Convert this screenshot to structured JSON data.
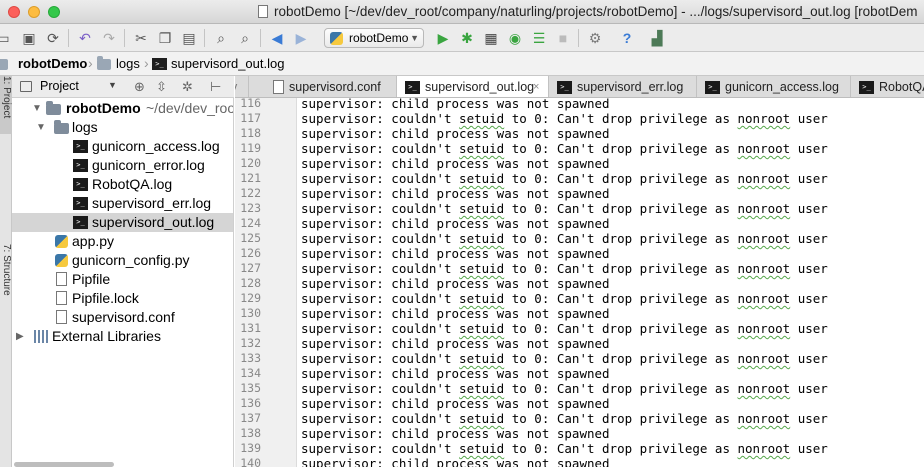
{
  "window": {
    "title": "robotDemo [~/dev/dev_root/company/naturling/projects/robotDemo] - .../logs/supervisord_out.log [robotDem"
  },
  "toolbar": {
    "run_config": "robotDemo",
    "icons": [
      "folder-open-icon",
      "save-icon",
      "sync-icon",
      "undo-icon",
      "redo-icon",
      "cut-icon",
      "copy-icon",
      "paste-icon",
      "find-icon",
      "replace-icon",
      "back-icon",
      "forward-icon",
      "run-icon",
      "debug-icon",
      "coverage-icon",
      "profile-icon",
      "concurrency-icon",
      "stop-icon",
      "settings-icon",
      "help-icon",
      "terminal-icon"
    ]
  },
  "breadcrumb": {
    "items": [
      "robotDemo",
      "logs",
      "supervisord_out.log"
    ]
  },
  "tool_strip": {
    "project_label": "1: Project",
    "structure_label": "7: Structure"
  },
  "project_panel": {
    "title": "Project",
    "tree": [
      {
        "label": "robotDemo",
        "path": "~/dev/dev_root/c"
      },
      {
        "label": "logs"
      },
      {
        "label": "gunicorn_access.log"
      },
      {
        "label": "gunicorn_error.log"
      },
      {
        "label": "RobotQA.log"
      },
      {
        "label": "supervisord_err.log"
      },
      {
        "label": "supervisord_out.log"
      },
      {
        "label": "app.py"
      },
      {
        "label": "gunicorn_config.py"
      },
      {
        "label": "Pipfile"
      },
      {
        "label": "Pipfile.lock"
      },
      {
        "label": "supervisord.conf"
      },
      {
        "label": "External Libraries"
      }
    ]
  },
  "tabs": [
    {
      "label": "y"
    },
    {
      "label": "supervisord.conf"
    },
    {
      "label": "supervisord_out.log"
    },
    {
      "label": "supervisord_err.log"
    },
    {
      "label": "gunicorn_access.log"
    },
    {
      "label": "RobotQA"
    }
  ],
  "editor": {
    "lines": [
      {
        "n": "116",
        "pre": "supervisor: child process was not spawned",
        "word": "",
        "post": ""
      },
      {
        "n": "117",
        "pre": "supervisor: couldn't ",
        "word": "setuid",
        "post": " to 0: Can't drop privilege as ",
        "word2": "nonroot",
        "post2": " user"
      },
      {
        "n": "118",
        "pre": "supervisor: child process was not spawned",
        "word": "",
        "post": ""
      },
      {
        "n": "119",
        "pre": "supervisor: couldn't ",
        "word": "setuid",
        "post": " to 0: Can't drop privilege as ",
        "word2": "nonroot",
        "post2": " user"
      },
      {
        "n": "120",
        "pre": "supervisor: child process was not spawned",
        "word": "",
        "post": ""
      },
      {
        "n": "121",
        "pre": "supervisor: couldn't ",
        "word": "setuid",
        "post": " to 0: Can't drop privilege as ",
        "word2": "nonroot",
        "post2": " user"
      },
      {
        "n": "122",
        "pre": "supervisor: child process was not spawned",
        "word": "",
        "post": ""
      },
      {
        "n": "123",
        "pre": "supervisor: couldn't ",
        "word": "setuid",
        "post": " to 0: Can't drop privilege as ",
        "word2": "nonroot",
        "post2": " user"
      },
      {
        "n": "124",
        "pre": "supervisor: child process was not spawned",
        "word": "",
        "post": ""
      },
      {
        "n": "125",
        "pre": "supervisor: couldn't ",
        "word": "setuid",
        "post": " to 0: Can't drop privilege as ",
        "word2": "nonroot",
        "post2": " user"
      },
      {
        "n": "126",
        "pre": "supervisor: child process was not spawned",
        "word": "",
        "post": ""
      },
      {
        "n": "127",
        "pre": "supervisor: couldn't ",
        "word": "setuid",
        "post": " to 0: Can't drop privilege as ",
        "word2": "nonroot",
        "post2": " user"
      },
      {
        "n": "128",
        "pre": "supervisor: child process was not spawned",
        "word": "",
        "post": ""
      },
      {
        "n": "129",
        "pre": "supervisor: couldn't ",
        "word": "setuid",
        "post": " to 0: Can't drop privilege as ",
        "word2": "nonroot",
        "post2": " user"
      },
      {
        "n": "130",
        "pre": "supervisor: child process was not spawned",
        "word": "",
        "post": ""
      },
      {
        "n": "131",
        "pre": "supervisor: couldn't ",
        "word": "setuid",
        "post": " to 0: Can't drop privilege as ",
        "word2": "nonroot",
        "post2": " user"
      },
      {
        "n": "132",
        "pre": "supervisor: child process was not spawned",
        "word": "",
        "post": ""
      },
      {
        "n": "133",
        "pre": "supervisor: couldn't ",
        "word": "setuid",
        "post": " to 0: Can't drop privilege as ",
        "word2": "nonroot",
        "post2": " user"
      },
      {
        "n": "134",
        "pre": "supervisor: child process was not spawned",
        "word": "",
        "post": ""
      },
      {
        "n": "135",
        "pre": "supervisor: couldn't ",
        "word": "setuid",
        "post": " to 0: Can't drop privilege as ",
        "word2": "nonroot",
        "post2": " user"
      },
      {
        "n": "136",
        "pre": "supervisor: child process was not spawned",
        "word": "",
        "post": ""
      },
      {
        "n": "137",
        "pre": "supervisor: couldn't ",
        "word": "setuid",
        "post": " to 0: Can't drop privilege as ",
        "word2": "nonroot",
        "post2": " user"
      },
      {
        "n": "138",
        "pre": "supervisor: child process was not spawned",
        "word": "",
        "post": ""
      },
      {
        "n": "139",
        "pre": "supervisor: couldn't ",
        "word": "setuid",
        "post": " to 0: Can't drop privilege as ",
        "word2": "nonroot",
        "post2": " user"
      },
      {
        "n": "140",
        "pre": "supervisor: child process was not spawned",
        "word": "",
        "post": ""
      }
    ]
  },
  "colors": {
    "selection": "#d5d5d5",
    "run_green": "#3aa540",
    "spell_squiggle": "#56a64b"
  }
}
